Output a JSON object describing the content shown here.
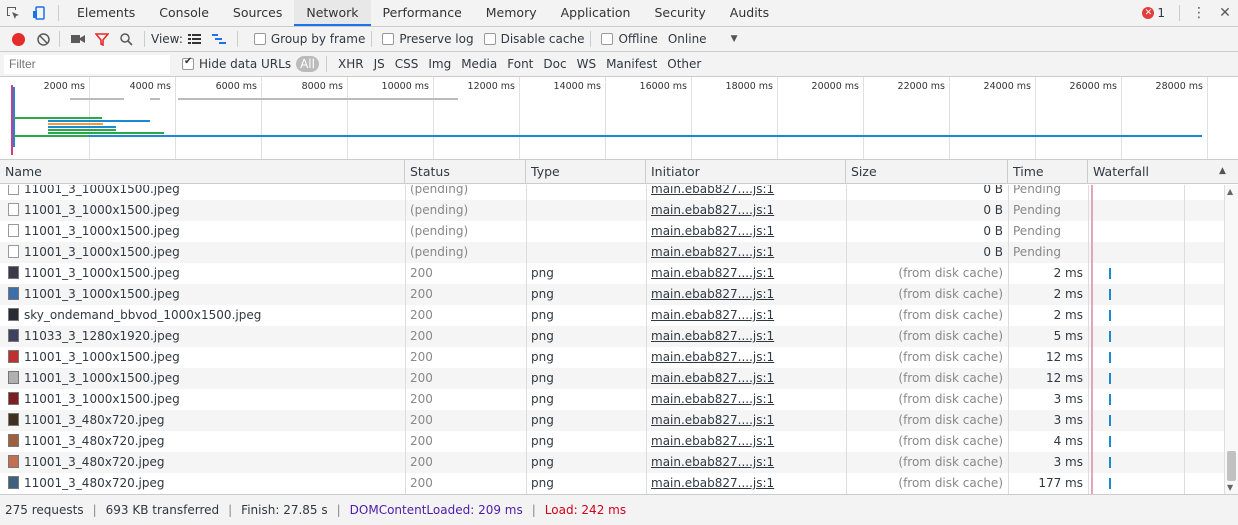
{
  "tabbar": {
    "tabs": [
      "Elements",
      "Console",
      "Sources",
      "Network",
      "Performance",
      "Memory",
      "Application",
      "Security",
      "Audits"
    ],
    "active_index": 3,
    "error_count": "1"
  },
  "toolbar": {
    "view_label": "View:",
    "group_by_frame": "Group by frame",
    "preserve_log": "Preserve log",
    "disable_cache": "Disable cache",
    "offline": "Offline",
    "throttle_value": "Online"
  },
  "filterbar": {
    "placeholder": "Filter",
    "hide_data_urls": "Hide data URLs",
    "types": [
      "All",
      "XHR",
      "JS",
      "CSS",
      "Img",
      "Media",
      "Font",
      "Doc",
      "WS",
      "Manifest",
      "Other"
    ]
  },
  "overview": {
    "ticks": [
      "2000 ms",
      "4000 ms",
      "6000 ms",
      "8000 ms",
      "10000 ms",
      "12000 ms",
      "14000 ms",
      "16000 ms",
      "18000 ms",
      "20000 ms",
      "22000 ms",
      "24000 ms",
      "26000 ms",
      "28000 ms"
    ]
  },
  "columns": [
    "Name",
    "Status",
    "Type",
    "Initiator",
    "Size",
    "Time",
    "Waterfall"
  ],
  "rows": [
    {
      "name": "11001_3_1000x1500.jpeg",
      "status": "(pending)",
      "type": "",
      "initiator": "main.ebab827....js:1",
      "size": "0 B",
      "time": "Pending",
      "thumb": "blank"
    },
    {
      "name": "11001_3_1000x1500.jpeg",
      "status": "(pending)",
      "type": "",
      "initiator": "main.ebab827....js:1",
      "size": "0 B",
      "time": "Pending",
      "thumb": "blank"
    },
    {
      "name": "11001_3_1000x1500.jpeg",
      "status": "(pending)",
      "type": "",
      "initiator": "main.ebab827....js:1",
      "size": "0 B",
      "time": "Pending",
      "thumb": "blank"
    },
    {
      "name": "11001_3_1000x1500.jpeg",
      "status": "(pending)",
      "type": "",
      "initiator": "main.ebab827....js:1",
      "size": "0 B",
      "time": "Pending",
      "thumb": "blank"
    },
    {
      "name": "11001_3_1000x1500.jpeg",
      "status": "200",
      "type": "png",
      "initiator": "main.ebab827....js:1",
      "size": "(from disk cache)",
      "time": "2 ms",
      "thumb": "#3a3a4a"
    },
    {
      "name": "11001_3_1000x1500.jpeg",
      "status": "200",
      "type": "png",
      "initiator": "main.ebab827....js:1",
      "size": "(from disk cache)",
      "time": "2 ms",
      "thumb": "#3d6fa8"
    },
    {
      "name": "sky_ondemand_bbvod_1000x1500.jpeg",
      "status": "200",
      "type": "png",
      "initiator": "main.ebab827....js:1",
      "size": "(from disk cache)",
      "time": "2 ms",
      "thumb": "#2a2a35"
    },
    {
      "name": "11033_3_1280x1920.jpeg",
      "status": "200",
      "type": "png",
      "initiator": "main.ebab827....js:1",
      "size": "(from disk cache)",
      "time": "5 ms",
      "thumb": "#404060"
    },
    {
      "name": "11001_3_1000x1500.jpeg",
      "status": "200",
      "type": "png",
      "initiator": "main.ebab827....js:1",
      "size": "(from disk cache)",
      "time": "12 ms",
      "thumb": "#c03030"
    },
    {
      "name": "11001_3_1000x1500.jpeg",
      "status": "200",
      "type": "png",
      "initiator": "main.ebab827....js:1",
      "size": "(from disk cache)",
      "time": "12 ms",
      "thumb": "#b0b0b0"
    },
    {
      "name": "11001_3_1000x1500.jpeg",
      "status": "200",
      "type": "png",
      "initiator": "main.ebab827....js:1",
      "size": "(from disk cache)",
      "time": "3 ms",
      "thumb": "#7a2020"
    },
    {
      "name": "11001_3_480x720.jpeg",
      "status": "200",
      "type": "png",
      "initiator": "main.ebab827....js:1",
      "size": "(from disk cache)",
      "time": "3 ms",
      "thumb": "#403020"
    },
    {
      "name": "11001_3_480x720.jpeg",
      "status": "200",
      "type": "png",
      "initiator": "main.ebab827....js:1",
      "size": "(from disk cache)",
      "time": "4 ms",
      "thumb": "#a06040"
    },
    {
      "name": "11001_3_480x720.jpeg",
      "status": "200",
      "type": "png",
      "initiator": "main.ebab827....js:1",
      "size": "(from disk cache)",
      "time": "3 ms",
      "thumb": "#c07050"
    },
    {
      "name": "11001_3_480x720.jpeg",
      "status": "200",
      "type": "png",
      "initiator": "main.ebab827....js:1",
      "size": "(from disk cache)",
      "time": "177 ms",
      "thumb": "#406080"
    }
  ],
  "status_bar": {
    "requests": "275 requests",
    "transferred": "693 KB transferred",
    "finish": "Finish: 27.85 s",
    "dom_content_loaded": "DOMContentLoaded: 209 ms",
    "load": "Load: 242 ms",
    "dcl_color": "#4f1ca8",
    "load_color": "#d0021b"
  }
}
